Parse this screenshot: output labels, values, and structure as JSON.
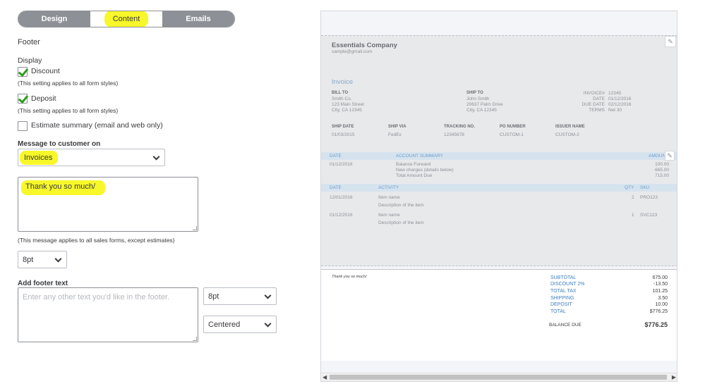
{
  "tabs": [
    {
      "label": "Design"
    },
    {
      "label": "Content"
    },
    {
      "label": "Emails"
    }
  ],
  "footer": {
    "title": "Footer",
    "display_label": "Display",
    "discount": {
      "label": "Discount",
      "checked": true,
      "note": "(This setting applies to all form styles)"
    },
    "deposit": {
      "label": "Deposit",
      "checked": true,
      "note": "(This setting applies to all form styles)"
    },
    "estimate_summary": {
      "label": "Estimate summary (email and web only)",
      "checked": false
    },
    "message_label": "Message to customer on",
    "message_on": "Invoices",
    "message_text": "Thank you so much/",
    "message_note": "(This message applies to all sales forms, except estimates)",
    "message_font_size": "8pt",
    "add_footer_label": "Add footer text",
    "footer_placeholder": "Enter any other text you'd like in the footer.",
    "footer_font_size": "8pt",
    "footer_alignment": "Centered"
  },
  "invoice": {
    "company": "Essentials Company",
    "email": "sample@gmail.com",
    "title": "Invoice",
    "bill_to_label": "BILL TO",
    "bill_to": [
      "Smith Co.",
      "123 Main Street",
      "City, CA 12345"
    ],
    "ship_to_label": "SHIP TO",
    "ship_to": [
      "John Smith",
      "20637 Palm Drive",
      "City, CA 12345"
    ],
    "meta": [
      {
        "label": "INVOICE#",
        "value": "12345"
      },
      {
        "label": "DATE",
        "value": "01/12/2016"
      },
      {
        "label": "DUE DATE",
        "value": "02/12/2016"
      },
      {
        "label": "TERMS",
        "value": "Net 30"
      }
    ],
    "shipping_headers": [
      "SHIP DATE",
      "SHIP VIA",
      "TRACKING NO.",
      "PO NUMBER",
      "ISSUER NAME"
    ],
    "shipping_values": [
      "01/03/2015",
      "FedEx",
      "12345678",
      "CUSTOM-1",
      "CUSTOM-2"
    ],
    "account_headers": [
      "DATE",
      "ACCOUNT SUMMARY",
      "AMOUN"
    ],
    "account_date": "01/12/2016",
    "account_rows": [
      {
        "label": "Balance Forward",
        "value": "100.00"
      },
      {
        "label": "New charges (details below)",
        "value": "665.00"
      },
      {
        "label": "Total Amount Due",
        "value": "715.00"
      }
    ],
    "activity_headers": [
      "DATE",
      "ACTIVITY",
      "QTY",
      "SKU"
    ],
    "activity_rows": [
      {
        "date": "12/01/2016",
        "name": "Item name",
        "desc": "Description of the item",
        "qty": "2",
        "sku": "PRO123"
      },
      {
        "date": "01/12/2016",
        "name": "Item name",
        "desc": "Description of the item",
        "qty": "1",
        "sku": "SVC123"
      }
    ],
    "footer_message": "Thank you so much/",
    "totals": [
      {
        "label": "SUBTOTAL",
        "value": "675.00"
      },
      {
        "label": "DISCOUNT 2%",
        "value": "-13.50"
      },
      {
        "label": "TOTAL TAX",
        "value": "101.25"
      },
      {
        "label": "SHIPPING",
        "value": "3.50"
      },
      {
        "label": "DEPOSIT",
        "value": "10.00"
      },
      {
        "label": "TOTAL",
        "value": "$776.25"
      }
    ],
    "balance_due_label": "BALANCE DUE",
    "balance_due": "$776.25"
  },
  "colors": {
    "highlight": "#f7f72a",
    "tab_inactive": "#8d9096",
    "check_green": "#2ca01c",
    "totals_blue": "#3d7fc1",
    "preview_bar": "#d5e3ef"
  },
  "icons": [
    "check-icon",
    "chevron-down-icon",
    "pencil-icon",
    "resize-grip-icon",
    "scroll-left-icon",
    "scroll-right-icon"
  ]
}
